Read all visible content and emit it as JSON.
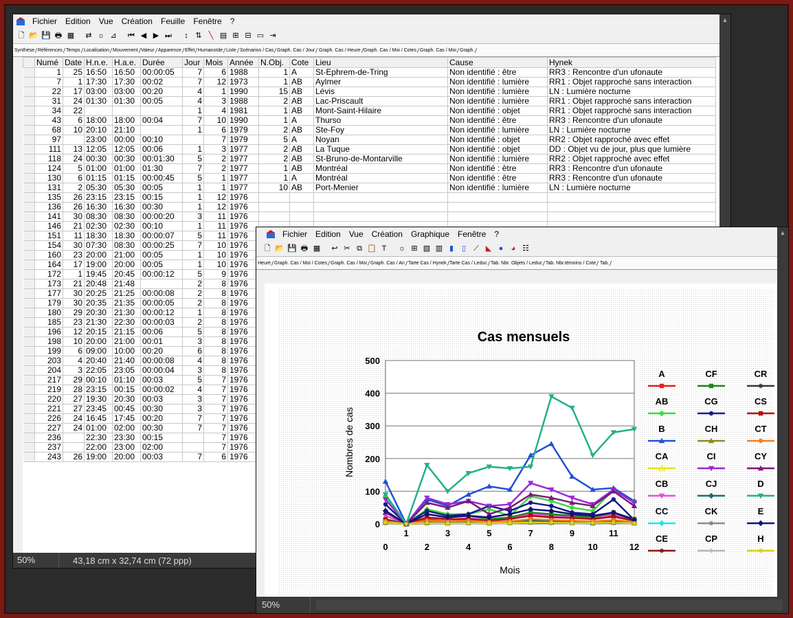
{
  "win1": {
    "menu": [
      "Fichier",
      "Edition",
      "Vue",
      "Création",
      "Feuille",
      "Fenêtre",
      "?"
    ],
    "tabs": [
      "Synthèse",
      "Références",
      "Temps",
      "Localisation",
      "Mouvement",
      "Valeur",
      "Apparence",
      "Effet",
      "Humanoïde",
      "Liste",
      "Scénarios / Cas",
      "Graph. Cas / Jour",
      "Graph. Cas / Heure",
      "Graph. Cas / Moi / Cotes",
      "Graph. Cas / Moi",
      "Graph."
    ],
    "columns": [
      "Numé",
      "Date",
      "H.n.e.",
      "H.a.e.",
      "Durée",
      "Jour",
      "Mois",
      "Année",
      "N.Obj.",
      "Cote",
      "Lieu",
      "Cause",
      "Hynek"
    ],
    "rows": [
      [
        "1",
        "25",
        "16:50",
        "16:50",
        "00:00:05",
        "7",
        "6",
        "1988",
        "1",
        "A",
        "St-Ephrem-de-Tring",
        "Non identifié : être",
        "RR3 : Rencontre d'un ufonaute"
      ],
      [
        "7",
        "1",
        "17:30",
        "17:30",
        "00:02",
        "7",
        "12",
        "1973",
        "1",
        "AB",
        "Aylmer",
        "Non identifié : lumière",
        "RR1 : Objet rapproché sans interaction"
      ],
      [
        "22",
        "17",
        "03:00",
        "03:00",
        "00:20",
        "4",
        "1",
        "1990",
        "15",
        "AB",
        "Lévis",
        "Non identifié : lumière",
        "LN : Lumière nocturne"
      ],
      [
        "31",
        "24",
        "01:30",
        "01:30",
        "00:05",
        "4",
        "3",
        "1988",
        "2",
        "AB",
        "Lac-Priscault",
        "Non identifié : lumière",
        "RR1 : Objet rapproché sans interaction"
      ],
      [
        "34",
        "22",
        "",
        "",
        "",
        "1",
        "4",
        "1981",
        "1",
        "AB",
        "Mont-Saint-Hilaire",
        "Non identifié : objet",
        "RR1 : Objet rapproché sans interaction"
      ],
      [
        "43",
        "6",
        "18:00",
        "18:00",
        "00:04",
        "7",
        "10",
        "1990",
        "1",
        "A",
        "Thurso",
        "Non identifié : être",
        "RR3 : Rencontre d'un ufonaute"
      ],
      [
        "68",
        "10",
        "20:10",
        "21:10",
        "",
        "1",
        "6",
        "1979",
        "2",
        "AB",
        "Ste-Foy",
        "Non identifié : lumière",
        "LN : Lumière nocturne"
      ],
      [
        "97",
        "",
        "23:00",
        "00:00",
        "00:10",
        "",
        "7",
        "1979",
        "5",
        "A",
        "Noyan",
        "Non identifié : objet",
        "RR2 : Objet rapproché avec effet"
      ],
      [
        "111",
        "13",
        "12:05",
        "12:05",
        "00:06",
        "1",
        "3",
        "1977",
        "2",
        "AB",
        "La Tuque",
        "Non identifié : objet",
        "DD : Objet vu de jour, plus que lumière"
      ],
      [
        "118",
        "24",
        "00:30",
        "00:30",
        "00:01:30",
        "5",
        "2",
        "1977",
        "2",
        "AB",
        "St-Bruno-de-Montarville",
        "Non identifié : lumière",
        "RR2 : Objet rapproché avec effet"
      ],
      [
        "124",
        "5",
        "01:00",
        "01:00",
        "01:30",
        "7",
        "2",
        "1977",
        "1",
        "AB",
        "Montréal",
        "Non identifié : être",
        "RR3 : Rencontre d'un ufonaute"
      ],
      [
        "130",
        "6",
        "01:15",
        "01:15",
        "00:00:45",
        "5",
        "1",
        "1977",
        "1",
        "A",
        "Montréal",
        "Non identifié : être",
        "RR3 : Rencontre d'un ufonaute"
      ],
      [
        "131",
        "2",
        "05:30",
        "05:30",
        "00:05",
        "1",
        "1",
        "1977",
        "10",
        "AB",
        "Port-Menier",
        "Non identifié : lumière",
        "LN : Lumière nocturne"
      ],
      [
        "135",
        "26",
        "23:15",
        "23:15",
        "00:15",
        "1",
        "12",
        "1976",
        "",
        "",
        "",
        "",
        ""
      ],
      [
        "136",
        "26",
        "16:30",
        "16:30",
        "00:30",
        "1",
        "12",
        "1976",
        "",
        "",
        "",
        "",
        ""
      ],
      [
        "141",
        "30",
        "08:30",
        "08:30",
        "00:00:20",
        "3",
        "11",
        "1976",
        "",
        "",
        "",
        "",
        ""
      ],
      [
        "146",
        "21",
        "02:30",
        "02:30",
        "00:10",
        "1",
        "11",
        "1976",
        "",
        "",
        "",
        "",
        ""
      ],
      [
        "151",
        "11",
        "18:30",
        "18:30",
        "00:00:07",
        "5",
        "11",
        "1976",
        "",
        "",
        "",
        "",
        ""
      ],
      [
        "154",
        "30",
        "07:30",
        "08:30",
        "00:00:25",
        "7",
        "10",
        "1976",
        "",
        "",
        "",
        "",
        ""
      ],
      [
        "160",
        "23",
        "20:00",
        "21:00",
        "00:05",
        "1",
        "10",
        "1976",
        "",
        "",
        "",
        "",
        ""
      ],
      [
        "164",
        "17",
        "19:00",
        "20:00",
        "00:05",
        "1",
        "10",
        "1976",
        "",
        "",
        "",
        "",
        ""
      ],
      [
        "172",
        "1",
        "19:45",
        "20:45",
        "00:00:12",
        "5",
        "9",
        "1976",
        "",
        "",
        "",
        "",
        ""
      ],
      [
        "173",
        "21",
        "20:48",
        "21:48",
        "",
        "2",
        "8",
        "1976",
        "",
        "",
        "",
        "",
        ""
      ],
      [
        "177",
        "30",
        "20:25",
        "21:25",
        "00:00:08",
        "2",
        "8",
        "1976",
        "",
        "",
        "",
        "",
        ""
      ],
      [
        "179",
        "30",
        "20:35",
        "21:35",
        "00:00:05",
        "2",
        "8",
        "1976",
        "",
        "",
        "",
        "",
        ""
      ],
      [
        "180",
        "29",
        "20:30",
        "21:30",
        "00:00:12",
        "1",
        "8",
        "1976",
        "",
        "",
        "",
        "",
        ""
      ],
      [
        "185",
        "23",
        "21:30",
        "22:30",
        "00:00:03",
        "2",
        "8",
        "1976",
        "",
        "",
        "",
        "",
        ""
      ],
      [
        "196",
        "12",
        "20:15",
        "21:15",
        "00:06",
        "5",
        "8",
        "1976",
        "",
        "",
        "",
        "",
        ""
      ],
      [
        "198",
        "10",
        "20:00",
        "21:00",
        "00:01",
        "3",
        "8",
        "1976",
        "",
        "",
        "",
        "",
        ""
      ],
      [
        "199",
        "6",
        "09:00",
        "10:00",
        "00:20",
        "6",
        "8",
        "1976",
        "",
        "",
        "",
        "",
        ""
      ],
      [
        "203",
        "4",
        "20:40",
        "21:40",
        "00:00:08",
        "4",
        "8",
        "1976",
        "",
        "",
        "",
        "",
        ""
      ],
      [
        "204",
        "3",
        "22:05",
        "23:05",
        "00:00:04",
        "3",
        "8",
        "1976",
        "",
        "",
        "",
        "",
        ""
      ],
      [
        "217",
        "29",
        "00:10",
        "01:10",
        "00:03",
        "5",
        "7",
        "1976",
        "",
        "",
        "",
        "",
        ""
      ],
      [
        "219",
        "28",
        "23:15",
        "00:15",
        "00:00:02",
        "4",
        "7",
        "1976",
        "",
        "",
        "",
        "",
        ""
      ],
      [
        "220",
        "27",
        "19:30",
        "20:30",
        "00:03",
        "3",
        "7",
        "1976",
        "",
        "",
        "",
        "",
        ""
      ],
      [
        "221",
        "27",
        "23:45",
        "00:45",
        "00:30",
        "3",
        "7",
        "1976",
        "",
        "",
        "",
        "",
        ""
      ],
      [
        "226",
        "24",
        "16:45",
        "17:45",
        "00:20",
        "7",
        "7",
        "1976",
        "",
        "",
        "",
        "",
        ""
      ],
      [
        "227",
        "24",
        "01:00",
        "02:00",
        "00:30",
        "7",
        "7",
        "1976",
        "",
        "",
        "",
        "",
        ""
      ],
      [
        "236",
        "",
        "22:30",
        "23:30",
        "00:15",
        "",
        "7",
        "1976",
        "",
        "",
        "",
        "",
        ""
      ],
      [
        "237",
        "",
        "22:00",
        "23:00",
        "02:00",
        "",
        "7",
        "1976",
        "",
        "",
        "",
        "",
        ""
      ],
      [
        "243",
        "26",
        "19:00",
        "20:00",
        "00:03",
        "7",
        "6",
        "1976",
        "",
        "",
        "",
        "",
        ""
      ]
    ],
    "status_zoom": "50%",
    "status_dims": "43,18 cm x 32,74 cm (72 ppp)"
  },
  "win2": {
    "menu": [
      "Fichier",
      "Edition",
      "Vue",
      "Création",
      "Graphique",
      "Fenêtre",
      "?"
    ],
    "tabs": [
      "Heure",
      "Graph. Cas / Moi / Cotes",
      "Graph. Cas / Moi",
      "Graph. Cas / An",
      "Tarte Cas / Hynek",
      "Tarte Cas / Leduc",
      "Tab. Nbr. Objets / Leduc",
      "Tab. Nbr.témoins / Cote",
      "Tab."
    ],
    "status_zoom": "50%"
  },
  "chart_data": {
    "type": "line",
    "title": "Cas mensuels",
    "xlabel": "Mois",
    "ylabel": "Nombres de cas",
    "x": [
      0,
      1,
      2,
      3,
      4,
      5,
      6,
      7,
      8,
      9,
      10,
      11,
      12
    ],
    "ylim": [
      0,
      500
    ],
    "yticks": [
      0,
      100,
      200,
      300,
      400,
      500
    ],
    "grid": true,
    "legend_position": "right",
    "series": [
      {
        "name": "A",
        "color": "#e8201a",
        "marker": "square",
        "values": [
          10,
          0,
          15,
          10,
          12,
          10,
          15,
          25,
          30,
          18,
          20,
          25,
          10
        ]
      },
      {
        "name": "AB",
        "color": "#3ed83e",
        "marker": "diamond",
        "values": [
          85,
          0,
          45,
          30,
          30,
          45,
          25,
          85,
          70,
          50,
          40,
          105,
          70
        ]
      },
      {
        "name": "B",
        "color": "#2050d8",
        "marker": "triangle",
        "values": [
          130,
          0,
          75,
          55,
          90,
          115,
          105,
          210,
          245,
          145,
          105,
          110,
          70
        ]
      },
      {
        "name": "CA",
        "color": "#e8e81a",
        "marker": "triangle-open",
        "values": [
          8,
          0,
          5,
          4,
          6,
          5,
          6,
          8,
          10,
          6,
          8,
          10,
          5
        ]
      },
      {
        "name": "CB",
        "color": "#e84ae8",
        "marker": "triangle-down",
        "values": [
          25,
          0,
          20,
          12,
          18,
          10,
          20,
          30,
          25,
          20,
          15,
          30,
          10
        ]
      },
      {
        "name": "CC",
        "color": "#1ae8e8",
        "marker": "diamond",
        "values": [
          5,
          0,
          4,
          3,
          4,
          3,
          4,
          6,
          5,
          4,
          3,
          5,
          3
        ]
      },
      {
        "name": "CE",
        "color": "#8a1a1a",
        "marker": "star",
        "values": [
          6,
          0,
          5,
          3,
          4,
          3,
          5,
          7,
          8,
          5,
          6,
          6,
          3
        ]
      },
      {
        "name": "CF",
        "color": "#1a8a1a",
        "marker": "square",
        "values": [
          15,
          0,
          30,
          20,
          25,
          15,
          20,
          35,
          30,
          25,
          20,
          35,
          15
        ]
      },
      {
        "name": "CG",
        "color": "#1a1a8a",
        "marker": "circle",
        "values": [
          60,
          0,
          40,
          25,
          30,
          55,
          40,
          65,
          55,
          35,
          30,
          75,
          12
        ]
      },
      {
        "name": "CH",
        "color": "#8a8a1a",
        "marker": "triangle",
        "values": [
          4,
          0,
          3,
          2,
          3,
          2,
          3,
          5,
          4,
          3,
          2,
          4,
          2
        ]
      },
      {
        "name": "CI",
        "color": "#9a2ad8",
        "marker": "triangle-down",
        "values": [
          75,
          0,
          80,
          60,
          70,
          55,
          60,
          125,
          105,
          80,
          60,
          105,
          65
        ]
      },
      {
        "name": "CJ",
        "color": "#1a6a6a",
        "marker": "diamond",
        "values": [
          5,
          0,
          8,
          4,
          6,
          4,
          6,
          12,
          10,
          8,
          6,
          10,
          5
        ]
      },
      {
        "name": "CK",
        "color": "#8a8a8a",
        "marker": "star",
        "values": [
          3,
          0,
          2,
          2,
          2,
          1,
          2,
          4,
          3,
          2,
          2,
          3,
          1
        ]
      },
      {
        "name": "CP",
        "color": "#b8b8b8",
        "marker": "plus",
        "values": [
          2,
          0,
          2,
          1,
          1,
          1,
          2,
          3,
          2,
          2,
          1,
          2,
          1
        ]
      },
      {
        "name": "CR",
        "color": "#3a3a3a",
        "marker": "star",
        "values": [
          3,
          0,
          2,
          2,
          3,
          2,
          3,
          4,
          3,
          3,
          2,
          3,
          2
        ]
      },
      {
        "name": "CS",
        "color": "#b01010",
        "marker": "square",
        "values": [
          12,
          0,
          20,
          15,
          15,
          10,
          15,
          25,
          20,
          18,
          15,
          22,
          10
        ]
      },
      {
        "name": "CT",
        "color": "#f08020",
        "marker": "circle",
        "values": [
          8,
          0,
          10,
          8,
          10,
          6,
          8,
          15,
          12,
          10,
          8,
          12,
          6
        ]
      },
      {
        "name": "CY",
        "color": "#7a1a7a",
        "marker": "triangle",
        "values": [
          35,
          0,
          65,
          50,
          70,
          30,
          50,
          90,
          80,
          65,
          55,
          100,
          55
        ]
      },
      {
        "name": "D",
        "color": "#22b08a",
        "marker": "triangle-down",
        "values": [
          90,
          0,
          180,
          100,
          155,
          175,
          170,
          175,
          390,
          355,
          210,
          280,
          290
        ]
      },
      {
        "name": "E",
        "color": "#10107a",
        "marker": "diamond",
        "values": [
          40,
          0,
          30,
          20,
          25,
          20,
          30,
          45,
          40,
          30,
          25,
          35,
          12
        ]
      },
      {
        "name": "H",
        "color": "#d8d020",
        "marker": "star",
        "values": [
          4,
          0,
          3,
          2,
          3,
          2,
          3,
          5,
          4,
          3,
          3,
          4,
          2
        ]
      }
    ]
  }
}
